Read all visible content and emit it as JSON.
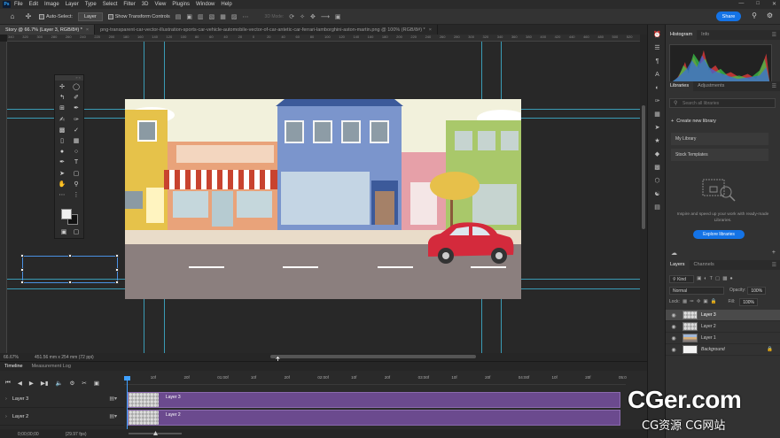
{
  "menubar": {
    "items": [
      "File",
      "Edit",
      "Image",
      "Layer",
      "Type",
      "Select",
      "Filter",
      "3D",
      "View",
      "Plugins",
      "Window",
      "Help"
    ]
  },
  "options": {
    "auto_select_label": "Auto-Select:",
    "auto_select_value": "Layer",
    "show_transform_label": "Show Transform Controls",
    "mode_3d": "3D Mode:",
    "share_label": "Share"
  },
  "tabs": [
    {
      "label": "Story @ 66.7% (Layer 3, RGB/8#) *",
      "active": true
    },
    {
      "label": "png-transparent-car-vector-illustration-sports-car-vehicle-automobile-vector-of-car-antetic-car-ferrari-lamborghini-aston-martin.png @ 100% (RGB/8#) *",
      "active": false
    }
  ],
  "ruler_top": [
    "340",
    "320",
    "300",
    "280",
    "260",
    "240",
    "220",
    "200",
    "180",
    "160",
    "140",
    "120",
    "100",
    "80",
    "60",
    "40",
    "20",
    "0",
    "20",
    "40",
    "60",
    "80",
    "100",
    "120",
    "140",
    "160",
    "180",
    "200",
    "220",
    "240",
    "260",
    "280",
    "300",
    "320",
    "340",
    "360",
    "380",
    "400",
    "420",
    "440",
    "460",
    "480",
    "500",
    "520"
  ],
  "status": {
    "zoom": "66.67%",
    "doc_size": "451.56 mm x 254 mm (72 ppi)"
  },
  "histogram_panel": {
    "tabs": [
      "Histogram",
      "Info"
    ]
  },
  "libraries_panel": {
    "tabs": [
      "Libraries",
      "Adjustments"
    ],
    "search_placeholder": "Search all libraries",
    "create_label": "Create new library",
    "items": [
      "My Library",
      "Stock Templates"
    ],
    "description": "Inspire and speed up your work with ready-made Libraries.",
    "explore_label": "Explore libraries"
  },
  "layers_panel": {
    "tabs": [
      "Layers",
      "Channels"
    ],
    "kind_label": "Kind",
    "blend_mode": "Normal",
    "opacity_label": "Opacity:",
    "opacity_value": "100%",
    "lock_label": "Lock:",
    "fill_label": "Fill:",
    "fill_value": "100%",
    "layers": [
      {
        "name": "Layer 3",
        "thumb": "checker",
        "active": true
      },
      {
        "name": "Layer 2",
        "thumb": "checker",
        "active": false
      },
      {
        "name": "Layer 1",
        "thumb": "image",
        "active": false
      },
      {
        "name": "Background",
        "thumb": "white",
        "active": false,
        "locked": true
      }
    ]
  },
  "timeline": {
    "tabs": [
      "Timeline",
      "Measurement Log"
    ],
    "ruler_ticks": [
      "10f",
      "20f",
      "01:00f",
      "10f",
      "20f",
      "02:00f",
      "10f",
      "20f",
      "03:00f",
      "10f",
      "20f",
      "04:00f",
      "10f",
      "20f",
      "05:0"
    ],
    "tracks": [
      "Layer 3",
      "Layer 2"
    ],
    "clip_names": [
      "Layer 3",
      "Layer 2"
    ],
    "timecode": "0;00;00;00",
    "fps": "(29.97 fps)"
  },
  "watermark": {
    "main": "CGer.com",
    "sub": "CG资源 CG网站"
  },
  "colors": {
    "accent": "#1473e6",
    "guide": "#3fb8d8",
    "clip": "#6b4a8e"
  }
}
